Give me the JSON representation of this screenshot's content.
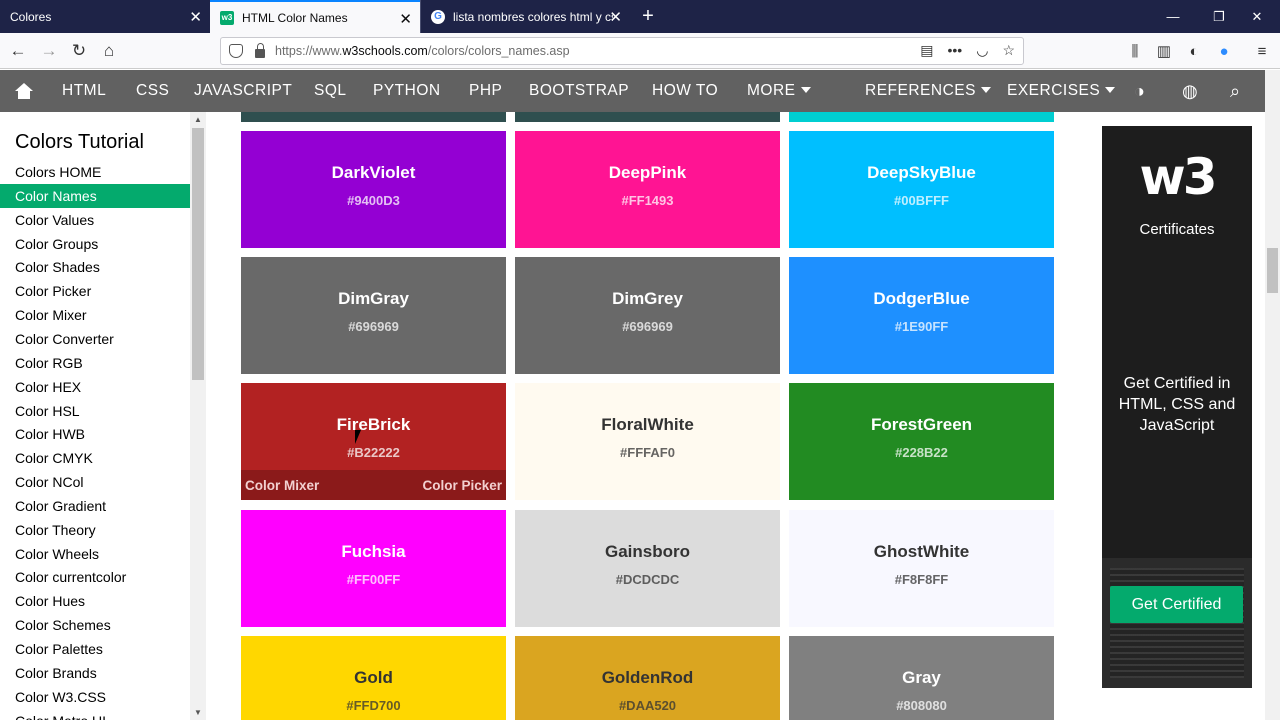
{
  "browser": {
    "tabs": [
      {
        "label": "Colores",
        "favicon": "blank"
      },
      {
        "label": "HTML Color Names",
        "favicon": "w3"
      },
      {
        "label": "lista nombres colores html y cs",
        "favicon": "google"
      }
    ],
    "url_prefix": "https://www.",
    "url_domain": "w3schools.com",
    "url_path": "/colors/colors_names.asp"
  },
  "menu": {
    "items": [
      "HTML",
      "CSS",
      "JAVASCRIPT",
      "SQL",
      "PYTHON",
      "PHP",
      "BOOTSTRAP",
      "HOW TO",
      "MORE"
    ],
    "right_items": [
      "REFERENCES",
      "EXERCISES"
    ]
  },
  "sidebar": {
    "title": "Colors Tutorial",
    "items": [
      "Colors HOME",
      "Color Names",
      "Color Values",
      "Color Groups",
      "Color Shades",
      "Color Picker",
      "Color Mixer",
      "Color Converter",
      "Color RGB",
      "Color HEX",
      "Color HSL",
      "Color HWB",
      "Color CMYK",
      "Color NCol",
      "Color Gradient",
      "Color Theory",
      "Color Wheels",
      "Color currentcolor",
      "Color Hues",
      "Color Schemes",
      "Color Palettes",
      "Color Brands",
      "Color W3.CSS",
      "Color Metro UI"
    ],
    "active_index": 1
  },
  "colors": [
    {
      "name": "DarkViolet",
      "hex": "#9400D3",
      "bg": "#9400D3",
      "fg": "#ffffff"
    },
    {
      "name": "DeepPink",
      "hex": "#FF1493",
      "bg": "#FF1493",
      "fg": "#ffffff"
    },
    {
      "name": "DeepSkyBlue",
      "hex": "#00BFFF",
      "bg": "#00BFFF",
      "fg": "#ffffff"
    },
    {
      "name": "DimGray",
      "hex": "#696969",
      "bg": "#696969",
      "fg": "#ffffff"
    },
    {
      "name": "DimGrey",
      "hex": "#696969",
      "bg": "#696969",
      "fg": "#ffffff"
    },
    {
      "name": "DodgerBlue",
      "hex": "#1E90FF",
      "bg": "#1E90FF",
      "fg": "#ffffff"
    },
    {
      "name": "FireBrick",
      "hex": "#B22222",
      "bg": "#B22222",
      "fg": "#ffffff"
    },
    {
      "name": "FloralWhite",
      "hex": "#FFFAF0",
      "bg": "#FFFAF0",
      "fg": "#333333"
    },
    {
      "name": "ForestGreen",
      "hex": "#228B22",
      "bg": "#228B22",
      "fg": "#ffffff"
    },
    {
      "name": "Fuchsia",
      "hex": "#FF00FF",
      "bg": "#FF00FF",
      "fg": "#ffffff"
    },
    {
      "name": "Gainsboro",
      "hex": "#DCDCDC",
      "bg": "#DCDCDC",
      "fg": "#333333"
    },
    {
      "name": "GhostWhite",
      "hex": "#F8F8FF",
      "bg": "#F8F8FF",
      "fg": "#333333"
    },
    {
      "name": "Gold",
      "hex": "#FFD700",
      "bg": "#FFD700",
      "fg": "#333333"
    },
    {
      "name": "GoldenRod",
      "hex": "#DAA520",
      "bg": "#DAA520",
      "fg": "#333333"
    },
    {
      "name": "Gray",
      "hex": "#808080",
      "bg": "#808080",
      "fg": "#ffffff"
    }
  ],
  "top_strip_colors": [
    "#2F4F4F",
    "#2F4F4F",
    "#00CED1"
  ],
  "hover_overlay": {
    "left": "Color Mixer",
    "right": "Color Picker"
  },
  "ad": {
    "logo": "w3",
    "certificates": "Certificates",
    "pitch": "Get Certified in HTML, CSS and JavaScript",
    "button": "Get Certified"
  }
}
